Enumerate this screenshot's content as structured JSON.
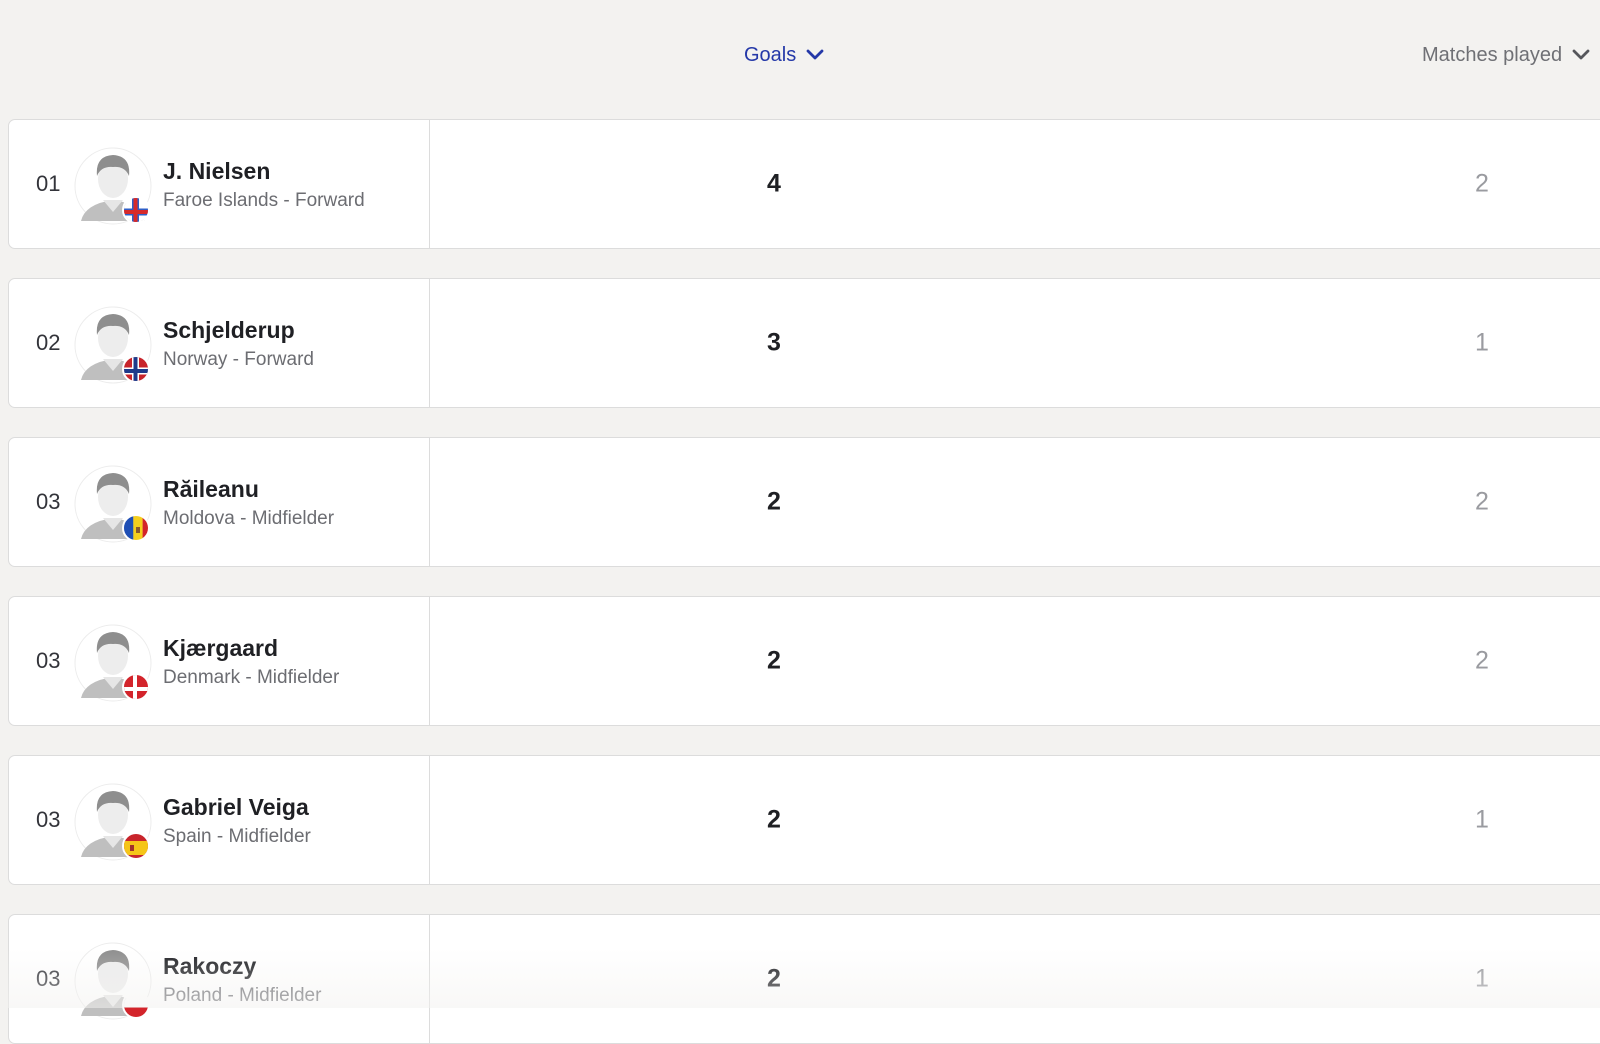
{
  "header": {
    "goals_label": "Goals",
    "matches_label": "Matches played"
  },
  "colors": {
    "accent": "#2438a8",
    "muted": "#6f7075",
    "background": "#f3f2f0"
  },
  "players": [
    {
      "rank": "01",
      "name": "J. Nielsen",
      "description": "Faroe Islands - Forward",
      "goals": "4",
      "matches": "2",
      "flag": "faroe-islands-flag-icon"
    },
    {
      "rank": "02",
      "name": "Schjelderup",
      "description": "Norway - Forward",
      "goals": "3",
      "matches": "1",
      "flag": "norway-flag-icon"
    },
    {
      "rank": "03",
      "name": "Răileanu",
      "description": "Moldova - Midfielder",
      "goals": "2",
      "matches": "2",
      "flag": "moldova-flag-icon"
    },
    {
      "rank": "03",
      "name": "Kjærgaard",
      "description": "Denmark - Midfielder",
      "goals": "2",
      "matches": "2",
      "flag": "denmark-flag-icon"
    },
    {
      "rank": "03",
      "name": "Gabriel Veiga",
      "description": "Spain - Midfielder",
      "goals": "2",
      "matches": "1",
      "flag": "spain-flag-icon"
    },
    {
      "rank": "03",
      "name": "Rakoczy",
      "description": "Poland - Midfielder",
      "goals": "2",
      "matches": "1",
      "flag": "poland-flag-icon"
    }
  ]
}
